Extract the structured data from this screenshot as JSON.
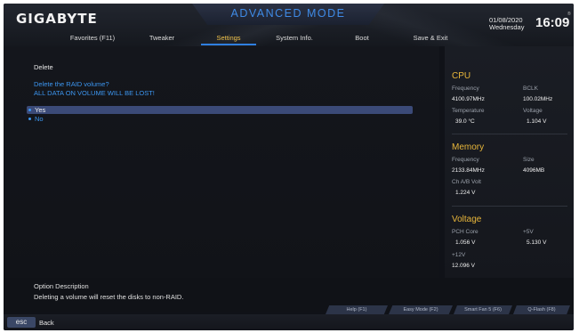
{
  "header": {
    "brand": "GIGABYTE",
    "mode_title": "ADVANCED MODE",
    "date": "01/08/2020",
    "weekday": "Wednesday",
    "time": "16:09",
    "reg_mark": "®",
    "tabs": [
      {
        "label": "Favorites (F11)"
      },
      {
        "label": "Tweaker"
      },
      {
        "label": "Settings"
      },
      {
        "label": "System Info."
      },
      {
        "label": "Boot"
      },
      {
        "label": "Save & Exit"
      }
    ],
    "active_tab": "Settings"
  },
  "main": {
    "page_title": "Delete",
    "prompt_line1": "Delete the RAID volume?",
    "prompt_line2": "ALL DATA ON VOLUME WILL BE LOST!",
    "options": [
      {
        "label": "Yes",
        "selected": true
      },
      {
        "label": "No",
        "selected": false
      }
    ]
  },
  "panel": {
    "cpu": {
      "title": "CPU",
      "frequency_label": "Frequency",
      "frequency_value": "4100.97MHz",
      "bclk_label": "BCLK",
      "bclk_value": "100.02MHz",
      "temperature_label": "Temperature",
      "temperature_value": "39.0 °C",
      "voltage_label": "Voltage",
      "voltage_value": "1.104 V"
    },
    "memory": {
      "title": "Memory",
      "frequency_label": "Frequency",
      "frequency_value": "2133.84MHz",
      "size_label": "Size",
      "size_value": "4096MB",
      "chab_label": "Ch A/B Volt",
      "chab_value": "1.224 V"
    },
    "voltage": {
      "title": "Voltage",
      "pch_label": "PCH Core",
      "pch_value": "1.056 V",
      "p5_label": "+5V",
      "p5_value": "5.130 V",
      "p12_label": "+12V",
      "p12_value": "12.096 V"
    }
  },
  "description": {
    "title": "Option Description",
    "text": "Deleting a volume will reset the disks to non-RAID."
  },
  "function_buttons": [
    {
      "label": "Help (F1)"
    },
    {
      "label": "Easy Mode (F2)"
    },
    {
      "label": "Smart Fan 5 (F6)"
    },
    {
      "label": "Q-Flash (F8)"
    }
  ],
  "footer": {
    "esc_label": "esc",
    "back_label": "Back"
  },
  "colors": {
    "accent_blue": "#3c96f0",
    "accent_gold": "#e8b63a",
    "selected_bg": "#3b4a78"
  }
}
